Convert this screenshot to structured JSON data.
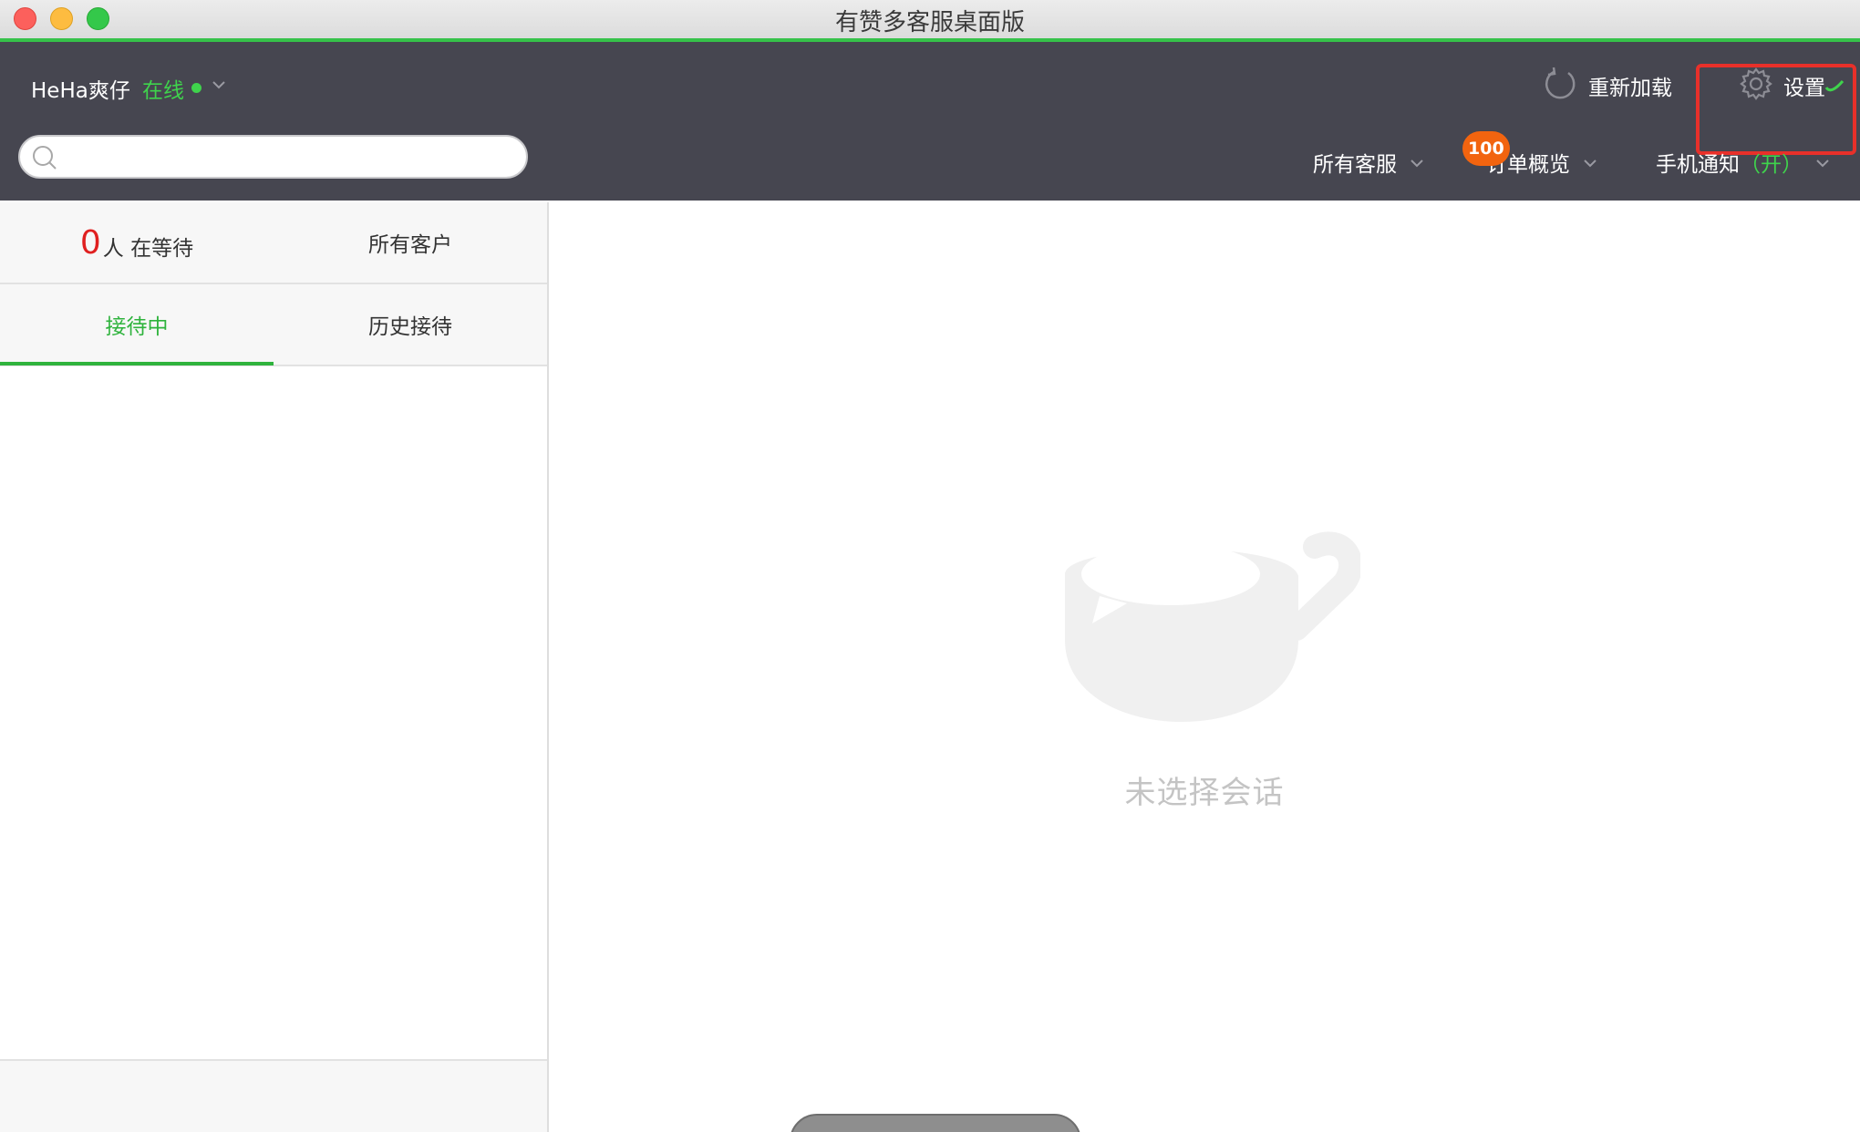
{
  "window": {
    "title": "有赞多客服桌面版"
  },
  "header": {
    "user_name": "HeHa爽仔",
    "status": "在线",
    "reload_label": "重新加载",
    "settings_label": "设置"
  },
  "search": {
    "placeholder": "",
    "value": ""
  },
  "nav": {
    "all_agents": "所有客服",
    "orders": "订单概览",
    "orders_badge": "100",
    "mobile_notify": "手机通知",
    "mobile_notify_state": "（开）"
  },
  "left_panel": {
    "waiting_count": "0",
    "waiting_label": "人 在等待",
    "all_customers": "所有客户",
    "tabs": [
      {
        "label": "接待中",
        "active": true
      },
      {
        "label": "历史接待",
        "active": false
      }
    ]
  },
  "main": {
    "empty_text": "未选择会话"
  },
  "colors": {
    "accent_green": "#2fb33d",
    "header_bg": "#464650",
    "badge_orange": "#f2640f",
    "highlight_red": "#e8302a",
    "waiting_red": "#e02020"
  },
  "icons": {
    "reload": "reload-icon",
    "settings": "gear-icon",
    "search": "search-icon",
    "empty_state": "coffee-cup-icon"
  }
}
